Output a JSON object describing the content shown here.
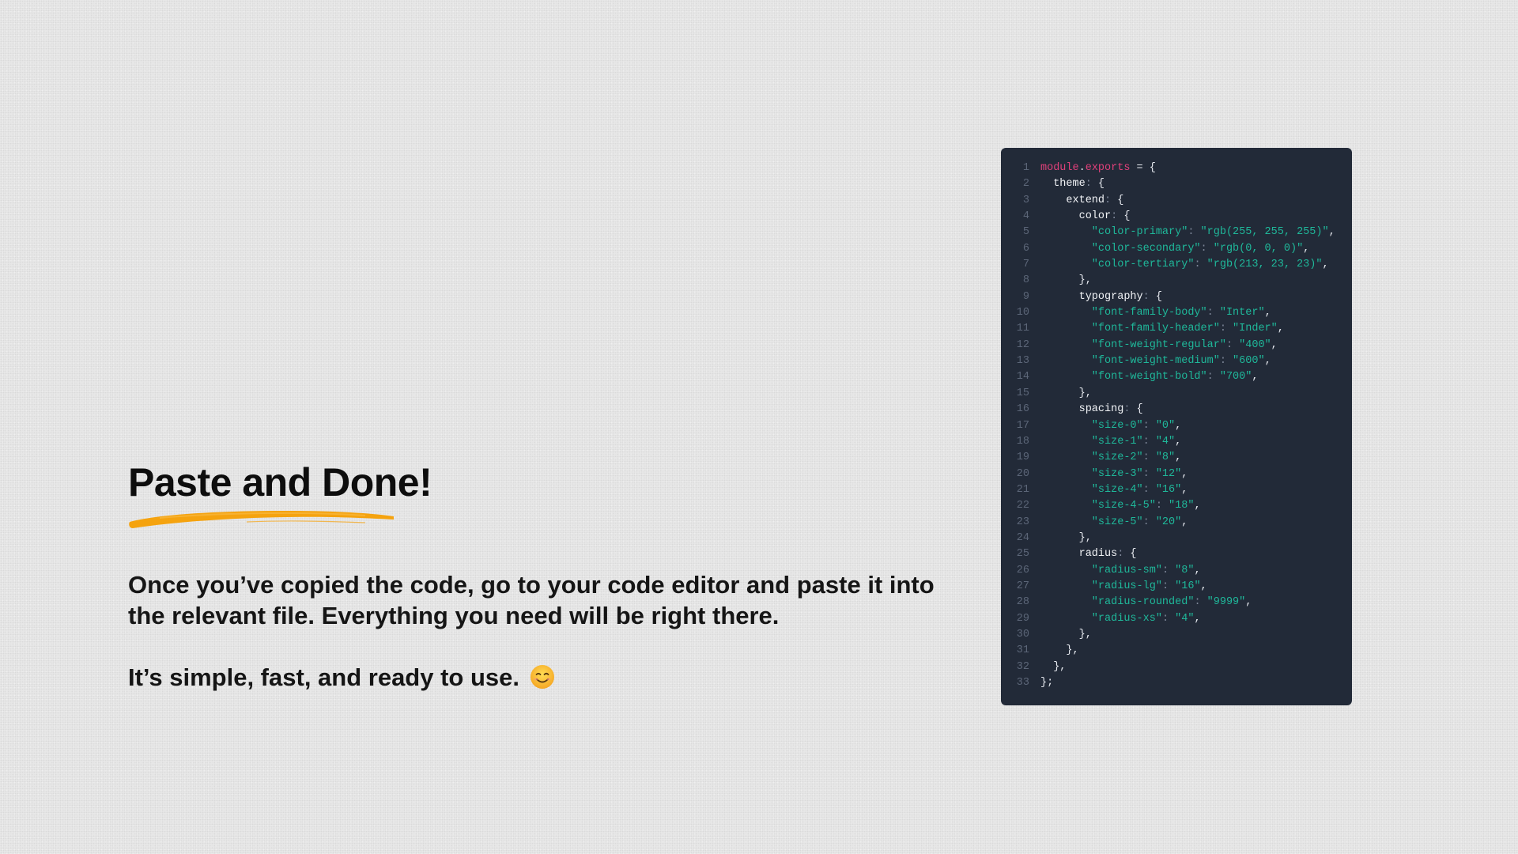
{
  "slide": {
    "title": "Paste and Done!",
    "paragraph_1": "Once you’ve copied the code, go to your code editor and paste it into the relevant file. Everything you need will be right there.",
    "paragraph_2": "It’s simple, fast, and ready to use.",
    "emoji_icon": "smiling-face-icon"
  },
  "colors": {
    "accent_underline": "#f5a30f",
    "code_background": "#222a38",
    "code_string": "#1fb89a",
    "code_keyword": "#e0407a"
  },
  "code": {
    "lines": [
      {
        "n": "1",
        "tokens": [
          [
            "kw",
            "module"
          ],
          [
            "dot",
            "."
          ],
          [
            "prop",
            "exports"
          ],
          [
            "op",
            " = "
          ],
          [
            "punct",
            "{"
          ]
        ]
      },
      {
        "n": "2",
        "tokens": [
          [
            "key",
            "  theme"
          ],
          [
            "colon",
            ": "
          ],
          [
            "punct",
            "{"
          ]
        ]
      },
      {
        "n": "3",
        "tokens": [
          [
            "key",
            "    extend"
          ],
          [
            "colon",
            ": "
          ],
          [
            "punct",
            "{"
          ]
        ]
      },
      {
        "n": "4",
        "tokens": [
          [
            "key",
            "      color"
          ],
          [
            "colon",
            ": "
          ],
          [
            "punct",
            "{"
          ]
        ]
      },
      {
        "n": "5",
        "tokens": [
          [
            "str",
            "        \"color-primary\""
          ],
          [
            "colon",
            ": "
          ],
          [
            "str",
            "\"rgb(255, 255, 255)\""
          ],
          [
            "punct",
            ","
          ]
        ]
      },
      {
        "n": "6",
        "tokens": [
          [
            "str",
            "        \"color-secondary\""
          ],
          [
            "colon",
            ": "
          ],
          [
            "str",
            "\"rgb(0, 0, 0)\""
          ],
          [
            "punct",
            ","
          ]
        ]
      },
      {
        "n": "7",
        "tokens": [
          [
            "str",
            "        \"color-tertiary\""
          ],
          [
            "colon",
            ": "
          ],
          [
            "str",
            "\"rgb(213, 23, 23)\""
          ],
          [
            "punct",
            ","
          ]
        ]
      },
      {
        "n": "8",
        "tokens": [
          [
            "punct",
            "      },"
          ]
        ]
      },
      {
        "n": "9",
        "tokens": [
          [
            "key",
            "      typography"
          ],
          [
            "colon",
            ": "
          ],
          [
            "punct",
            "{"
          ]
        ]
      },
      {
        "n": "10",
        "tokens": [
          [
            "str",
            "        \"font-family-body\""
          ],
          [
            "colon",
            ": "
          ],
          [
            "str",
            "\"Inter\""
          ],
          [
            "punct",
            ","
          ]
        ]
      },
      {
        "n": "11",
        "tokens": [
          [
            "str",
            "        \"font-family-header\""
          ],
          [
            "colon",
            ": "
          ],
          [
            "str",
            "\"Inder\""
          ],
          [
            "punct",
            ","
          ]
        ]
      },
      {
        "n": "12",
        "tokens": [
          [
            "str",
            "        \"font-weight-regular\""
          ],
          [
            "colon",
            ": "
          ],
          [
            "str",
            "\"400\""
          ],
          [
            "punct",
            ","
          ]
        ]
      },
      {
        "n": "13",
        "tokens": [
          [
            "str",
            "        \"font-weight-medium\""
          ],
          [
            "colon",
            ": "
          ],
          [
            "str",
            "\"600\""
          ],
          [
            "punct",
            ","
          ]
        ]
      },
      {
        "n": "14",
        "tokens": [
          [
            "str",
            "        \"font-weight-bold\""
          ],
          [
            "colon",
            ": "
          ],
          [
            "str",
            "\"700\""
          ],
          [
            "punct",
            ","
          ]
        ]
      },
      {
        "n": "15",
        "tokens": [
          [
            "punct",
            "      },"
          ]
        ]
      },
      {
        "n": "16",
        "tokens": [
          [
            "key",
            "      spacing"
          ],
          [
            "colon",
            ": "
          ],
          [
            "punct",
            "{"
          ]
        ]
      },
      {
        "n": "17",
        "tokens": [
          [
            "str",
            "        \"size-0\""
          ],
          [
            "colon",
            ": "
          ],
          [
            "str",
            "\"0\""
          ],
          [
            "punct",
            ","
          ]
        ]
      },
      {
        "n": "18",
        "tokens": [
          [
            "str",
            "        \"size-1\""
          ],
          [
            "colon",
            ": "
          ],
          [
            "str",
            "\"4\""
          ],
          [
            "punct",
            ","
          ]
        ]
      },
      {
        "n": "19",
        "tokens": [
          [
            "str",
            "        \"size-2\""
          ],
          [
            "colon",
            ": "
          ],
          [
            "str",
            "\"8\""
          ],
          [
            "punct",
            ","
          ]
        ]
      },
      {
        "n": "20",
        "tokens": [
          [
            "str",
            "        \"size-3\""
          ],
          [
            "colon",
            ": "
          ],
          [
            "str",
            "\"12\""
          ],
          [
            "punct",
            ","
          ]
        ]
      },
      {
        "n": "21",
        "tokens": [
          [
            "str",
            "        \"size-4\""
          ],
          [
            "colon",
            ": "
          ],
          [
            "str",
            "\"16\""
          ],
          [
            "punct",
            ","
          ]
        ]
      },
      {
        "n": "22",
        "tokens": [
          [
            "str",
            "        \"size-4-5\""
          ],
          [
            "colon",
            ": "
          ],
          [
            "str",
            "\"18\""
          ],
          [
            "punct",
            ","
          ]
        ]
      },
      {
        "n": "23",
        "tokens": [
          [
            "str",
            "        \"size-5\""
          ],
          [
            "colon",
            ": "
          ],
          [
            "str",
            "\"20\""
          ],
          [
            "punct",
            ","
          ]
        ]
      },
      {
        "n": "24",
        "tokens": [
          [
            "punct",
            "      },"
          ]
        ]
      },
      {
        "n": "25",
        "tokens": [
          [
            "key",
            "      radius"
          ],
          [
            "colon",
            ": "
          ],
          [
            "punct",
            "{"
          ]
        ]
      },
      {
        "n": "26",
        "tokens": [
          [
            "str",
            "        \"radius-sm\""
          ],
          [
            "colon",
            ": "
          ],
          [
            "str",
            "\"8\""
          ],
          [
            "punct",
            ","
          ]
        ]
      },
      {
        "n": "27",
        "tokens": [
          [
            "str",
            "        \"radius-lg\""
          ],
          [
            "colon",
            ": "
          ],
          [
            "str",
            "\"16\""
          ],
          [
            "punct",
            ","
          ]
        ]
      },
      {
        "n": "28",
        "tokens": [
          [
            "str",
            "        \"radius-rounded\""
          ],
          [
            "colon",
            ": "
          ],
          [
            "str",
            "\"9999\""
          ],
          [
            "punct",
            ","
          ]
        ]
      },
      {
        "n": "29",
        "tokens": [
          [
            "str",
            "        \"radius-xs\""
          ],
          [
            "colon",
            ": "
          ],
          [
            "str",
            "\"4\""
          ],
          [
            "punct",
            ","
          ]
        ]
      },
      {
        "n": "30",
        "tokens": [
          [
            "punct",
            "      },"
          ]
        ]
      },
      {
        "n": "31",
        "tokens": [
          [
            "punct",
            "    },"
          ]
        ]
      },
      {
        "n": "32",
        "tokens": [
          [
            "punct",
            "  },"
          ]
        ]
      },
      {
        "n": "33",
        "tokens": [
          [
            "punct",
            "};"
          ]
        ]
      }
    ]
  }
}
